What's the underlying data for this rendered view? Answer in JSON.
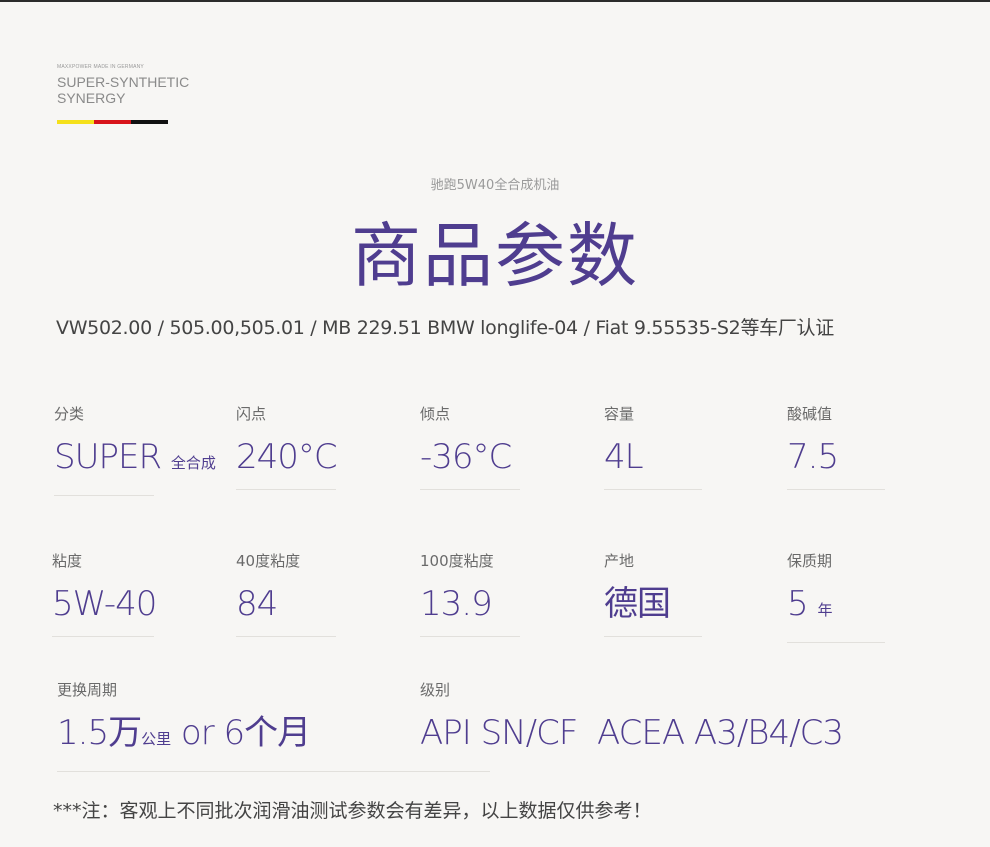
{
  "brand": {
    "tiny": "MAXXPOWER MADE IN GERMANY",
    "line1": "SUPER-SYNTHETIC",
    "line2": "SYNERGY",
    "flag_colors": [
      "#f5e01a",
      "#d8141a",
      "#111111"
    ]
  },
  "subtitle": "驰跑5W40全合成机油",
  "title": "商品参数",
  "cert": "VW502.00 / 505.00,505.01 / MB 229.51 BMW longlife-04 / Fiat 9.55535-S2等车厂认证",
  "params": {
    "category": {
      "label": "分类",
      "value": "SUPER",
      "suffix": "全合成"
    },
    "flash_point": {
      "label": "闪点",
      "value": "240°C"
    },
    "pour_point": {
      "label": "倾点",
      "value": "-36°C"
    },
    "capacity": {
      "label": "容量",
      "value": "4L"
    },
    "tbn": {
      "label": "酸碱值",
      "value": "7.5"
    },
    "viscosity": {
      "label": "粘度",
      "value": "5W-40"
    },
    "visc40": {
      "label": "40度粘度",
      "value": "84"
    },
    "visc100": {
      "label": "100度粘度",
      "value": "13.9"
    },
    "origin": {
      "label": "产地",
      "value": "德国"
    },
    "shelf_life": {
      "label": "保质期",
      "value": "5",
      "suffix": "年"
    },
    "interval": {
      "label": "更换周期",
      "value1": "1.5万",
      "unit": "公里",
      "value2": " or 6个月"
    },
    "grade": {
      "label": "级别",
      "value": "API SN/CF  ACEA A3/B4/C3"
    }
  },
  "footer": "***注：客观上不同批次润滑油测试参数会有差异，以上数据仅供参考！",
  "colors": {
    "accent": "#4f3d8f",
    "background": "#f7f6f4"
  }
}
